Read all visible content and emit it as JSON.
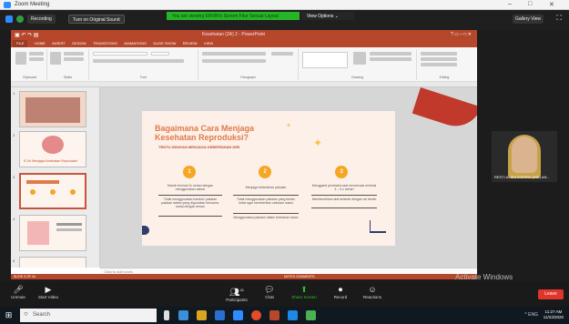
{
  "zoom_window": {
    "title": "Zoom Meeting",
    "controls": [
      "–",
      "□",
      "✕"
    ]
  },
  "share_bar": {
    "recording": "Recording",
    "original_sound": "Turn on Original Sound",
    "banner": "You are viewing ERVIN's Screen  Fitur Sesuai Layout",
    "view_options": "View Options ⌄",
    "gallery_view": "Gallery View"
  },
  "powerpoint": {
    "title": "Kesehatan (2A) 2 - PowerPoint",
    "tabs": [
      "FILE",
      "HOME",
      "INSERT",
      "DESIGN",
      "TRANSITIONS",
      "ANIMATIONS",
      "SLIDE SHOW",
      "REVIEW",
      "VIEW"
    ],
    "ribbon_groups": [
      "Clipboard",
      "Slides",
      "Font",
      "Paragraph",
      "Drawing",
      "Editing"
    ],
    "notes_placeholder": "Click to add notes",
    "status_left": "SLIDE 3 OF 16",
    "status_right": "NOTES   COMMENTS",
    "thumb_numbers": [
      "1",
      "2",
      "3",
      "4",
      "5"
    ],
    "thumb_caption": "5 Ciri Menjaga Kesehatan Reproduksi"
  },
  "slide": {
    "title_line1": "Bagaimana Cara Menjaga",
    "title_line2": "Kesehatan Reproduksi?",
    "subtitle": "TENTU DENGAN MENJAGA KEBERSIHAN DIRI",
    "steps": [
      {
        "num": "1",
        "text1": "Mandi minimal 2x sehari dengan menggunakan sabun",
        "text2": "Tidak menggunakan handuk/ pakaian pakaian dalam yang digunakan bersama-sama dengan teman"
      },
      {
        "num": "2",
        "text1": "Menjaga kebersihan pakaian",
        "text2": "Tidak menggunakan pakaian yang terlalu ketat agar memberikan sirkulasi udara",
        "text3": "Menggunakan pakaian dalam berbahan katun"
      },
      {
        "num": "3",
        "text1": "Mengganti pembalut saat menstruasi minimal 4 – 6 x sehari",
        "text2": "Membersihkan alat kelamin dengan air bersih"
      }
    ]
  },
  "video": {
    "participant": "RESTI ALISA RIZKIRA (NIK) AN..."
  },
  "zoom_controls": [
    {
      "icon": "mic",
      "label": "Unmute"
    },
    {
      "icon": "video",
      "label": "Start Video"
    },
    {
      "icon": "participants",
      "label": "Participants",
      "count": "41"
    },
    {
      "icon": "chat",
      "label": "Chat"
    },
    {
      "icon": "share",
      "label": "Share Screen"
    },
    {
      "icon": "record",
      "label": "Record"
    },
    {
      "icon": "reactions",
      "label": "Reactions"
    }
  ],
  "end_label": "Leave",
  "windows_watermark": {
    "line1": "Activate Windows",
    "line2": "Go to Settings to activate Windows."
  },
  "taskbar": {
    "search_placeholder": "Search",
    "tray": "^  ENG",
    "time": "11:27 AM",
    "date": "11/23/2020"
  },
  "colors": {
    "ppt_accent": "#b7472a",
    "slide_bg": "#fdf0e8",
    "slide_title": "#e07a4a",
    "step_circle": "#f5a623",
    "share_banner": "#26b526",
    "leave_button": "#e0352b"
  }
}
